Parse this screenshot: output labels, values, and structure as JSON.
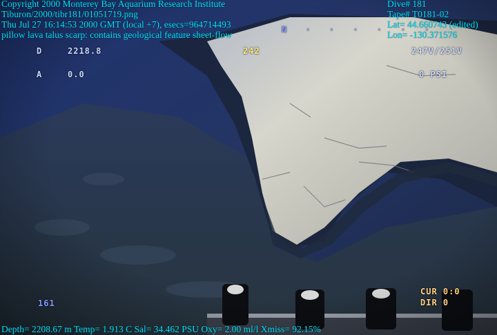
{
  "caption": {
    "copyright": "Copyright 2000 Monterey Bay Aquarium Research Institute",
    "file": "Tiburon/2000/tibr181/01051719.png",
    "timestamp": "Thu Jul 27 16:14:53 2000 GMT (local +7), esecs=964714493",
    "description": "pillow lava talus scarp: contains geological feature sheet-flow",
    "dive": "Dive# 181",
    "tape": "Tape# T0181-02",
    "lat": "Lat= 44.660743 (edited)",
    "lon": "Lon= -130.371576",
    "telemetry": "Depth= 2208.67 m  Temp= 1.913 C  Sal= 34.462 PSU  Oxy= 2.00 ml/l  Xmiss= 92.15%"
  },
  "osd": {
    "depth_label": "D",
    "depth_value": "2218.8",
    "heading": "242",
    "camera_state": "247V/251V",
    "alt_label": "A",
    "alt_value": "0.0",
    "psi_label": "0  PSI",
    "counter": "161",
    "cur": "CUR 0:0",
    "dir": "DIR 0",
    "tick_marks": "N · · · · · ·"
  },
  "colors": {
    "caption_text": "#00e5ff",
    "water": "#1c2a48",
    "rock_face": "#cfd0c4",
    "sediment": "#2c3a4a"
  }
}
